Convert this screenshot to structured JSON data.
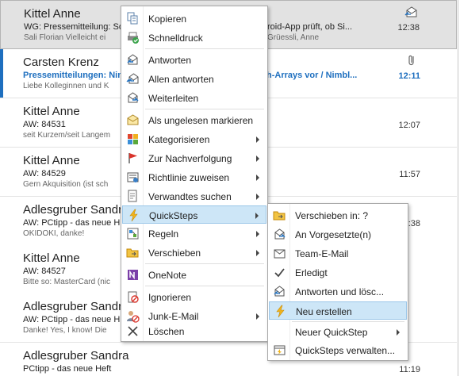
{
  "mails": [
    {
      "sender": "Kittel Anne",
      "subject": "WG: Pressemitteilung: So",
      "subject_tail": "roid-App prüft, ob Si...",
      "preview": "Sali Florian  Vielleicht ei",
      "preview_tail": "Grüessli, Anne",
      "time": "12:38",
      "icon": "reply-envelope-icon",
      "selected": true
    },
    {
      "sender": "Carsten Krenz",
      "subject": "Pressemitteilungen: Nin",
      "subject_tail": "h-Arrays vor / Nimbl...",
      "preview": "Liebe Kolleginnen und K",
      "time": "12:11",
      "icon": "paperclip-icon",
      "unread": true
    },
    {
      "sender": "Kittel Anne",
      "subject": "AW: 84531",
      "preview": "seit Kurzem/seit Langem",
      "time": "12:07"
    },
    {
      "sender": "Kittel Anne",
      "subject": "AW: 84529",
      "preview": "Gern Akquisition (ist sch",
      "time": "11:57"
    },
    {
      "sender": "Adlesgruber Sandra",
      "subject": "AW: PCtipp - das neue H",
      "preview": "OKIDOKI, danke!",
      "time": ":38"
    },
    {
      "sender": "Kittel Anne",
      "subject": "AW: 84527",
      "preview": "Bitte so: MasterCard (nic",
      "time": ""
    },
    {
      "sender": "Adlesgruber Sandra",
      "subject": "AW: PCtipp - das neue H",
      "preview": "Danke!  Yes, I know! Die",
      "time": ""
    },
    {
      "sender": "Adlesgruber Sandra",
      "subject": "PCtipp - das neue Heft",
      "preview": "",
      "time": "11:19"
    }
  ],
  "menu": {
    "kopieren": "Kopieren",
    "schnelldruck": "Schnelldruck",
    "antworten": "Antworten",
    "allen_antworten": "Allen antworten",
    "weiterleiten": "Weiterleiten",
    "als_ungelesen": "Als ungelesen markieren",
    "kategorisieren": "Kategorisieren",
    "nachverfolgung": "Zur Nachverfolgung",
    "richtlinie": "Richtlinie zuweisen",
    "verwandtes": "Verwandtes suchen",
    "quicksteps": "QuickSteps",
    "regeln": "Regeln",
    "verschieben": "Verschieben",
    "onenote": "OneNote",
    "ignorieren": "Ignorieren",
    "junk": "Junk-E-Mail",
    "loeschen": "Löschen"
  },
  "submenu": {
    "verschieben_in": "Verschieben in: ?",
    "an_vorgesetzte": "An Vorgesetzte(n)",
    "team_email": "Team-E-Mail",
    "erledigt": "Erledigt",
    "antworten_loeschen": "Antworten und lösc...",
    "neu_erstellen": "Neu erstellen",
    "neuer_quickstep": "Neuer QuickStep",
    "quicksteps_verwalten": "QuickSteps verwalten..."
  },
  "colors": {
    "accent": "#1e6fbf",
    "hover": "#cde6f7",
    "selected": "#e2e2e2"
  }
}
